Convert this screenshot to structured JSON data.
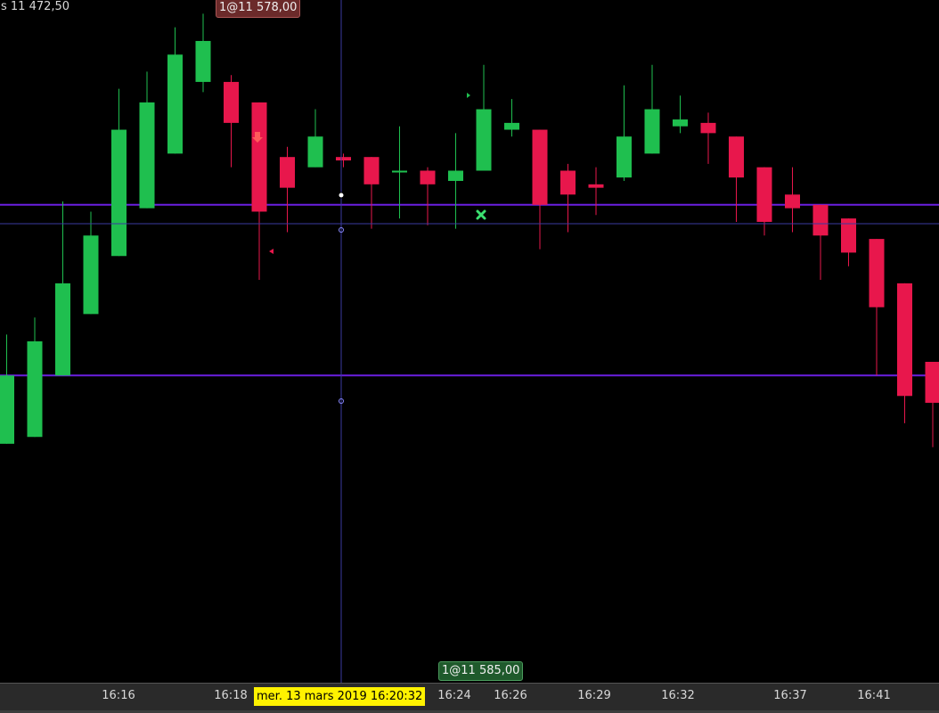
{
  "header": {
    "price_readout": "s 11 472,50"
  },
  "orders": {
    "sell_label": "1@11 578,00",
    "buy_label": "1@11 585,00"
  },
  "crosshair": {
    "time_label": "mer. 13 mars 2019 16:20:32"
  },
  "colors": {
    "background": "#000000",
    "up": "#1fbf4f",
    "down": "#e8174c",
    "level_line": "#6a1fe0",
    "crosshair": "#3a3aa0",
    "axis_bg": "#2a2a2a",
    "crosshair_label_bg": "#fff200"
  },
  "chart_data": {
    "type": "candlestick",
    "unit_note": "",
    "time_ticks": [
      "16:16",
      "16:18",
      "16:24",
      "16:26",
      "16:29",
      "16:32",
      "16:37",
      "16:41"
    ],
    "ylim": [
      11520,
      11720
    ],
    "levels": [
      11660,
      11610
    ],
    "candles": [
      {
        "o": 11590,
        "h": 11622,
        "l": 11590,
        "c": 11610
      },
      {
        "o": 11592,
        "h": 11627,
        "l": 11592,
        "c": 11620
      },
      {
        "o": 11610,
        "h": 11661,
        "l": 11610,
        "c": 11637
      },
      {
        "o": 11628,
        "h": 11658,
        "l": 11628,
        "c": 11651
      },
      {
        "o": 11645,
        "h": 11694,
        "l": 11645,
        "c": 11682
      },
      {
        "o": 11659,
        "h": 11699,
        "l": 11659,
        "c": 11690
      },
      {
        "o": 11675,
        "h": 11712,
        "l": 11675,
        "c": 11704
      },
      {
        "o": 11696,
        "h": 11716,
        "l": 11693,
        "c": 11708
      },
      {
        "o": 11696,
        "h": 11698,
        "l": 11671,
        "c": 11684
      },
      {
        "o": 11690,
        "h": 11690,
        "l": 11638,
        "c": 11658
      },
      {
        "o": 11674,
        "h": 11677,
        "l": 11652,
        "c": 11665
      },
      {
        "o": 11671,
        "h": 11688,
        "l": 11671,
        "c": 11680
      },
      {
        "o": 11674,
        "h": 11675,
        "l": 11671,
        "c": 11673
      },
      {
        "o": 11674,
        "h": 11674,
        "l": 11653,
        "c": 11666
      },
      {
        "o": 11670,
        "h": 11683,
        "l": 11656,
        "c": 11670
      },
      {
        "o": 11670,
        "h": 11671,
        "l": 11654,
        "c": 11666
      },
      {
        "o": 11667,
        "h": 11681,
        "l": 11653,
        "c": 11670
      },
      {
        "o": 11670,
        "h": 11701,
        "l": 11670,
        "c": 11688
      },
      {
        "o": 11682,
        "h": 11691,
        "l": 11680,
        "c": 11684
      },
      {
        "o": 11682,
        "h": 11682,
        "l": 11647,
        "c": 11660
      },
      {
        "o": 11670,
        "h": 11672,
        "l": 11652,
        "c": 11663
      },
      {
        "o": 11666,
        "h": 11671,
        "l": 11657,
        "c": 11665
      },
      {
        "o": 11668,
        "h": 11695,
        "l": 11667,
        "c": 11680
      },
      {
        "o": 11675,
        "h": 11701,
        "l": 11675,
        "c": 11688
      },
      {
        "o": 11683,
        "h": 11692,
        "l": 11681,
        "c": 11685
      },
      {
        "o": 11684,
        "h": 11687,
        "l": 11672,
        "c": 11681
      },
      {
        "o": 11680,
        "h": 11680,
        "l": 11655,
        "c": 11668
      },
      {
        "o": 11671,
        "h": 11671,
        "l": 11651,
        "c": 11655
      },
      {
        "o": 11663,
        "h": 11671,
        "l": 11652,
        "c": 11659
      },
      {
        "o": 11660,
        "h": 11660,
        "l": 11638,
        "c": 11651
      },
      {
        "o": 11656,
        "h": 11656,
        "l": 11642,
        "c": 11646
      },
      {
        "o": 11650,
        "h": 11650,
        "l": 11610,
        "c": 11630
      },
      {
        "o": 11637,
        "h": 11637,
        "l": 11596,
        "c": 11604
      },
      {
        "o": 11614,
        "h": 11614,
        "l": 11589,
        "c": 11602
      }
    ]
  }
}
